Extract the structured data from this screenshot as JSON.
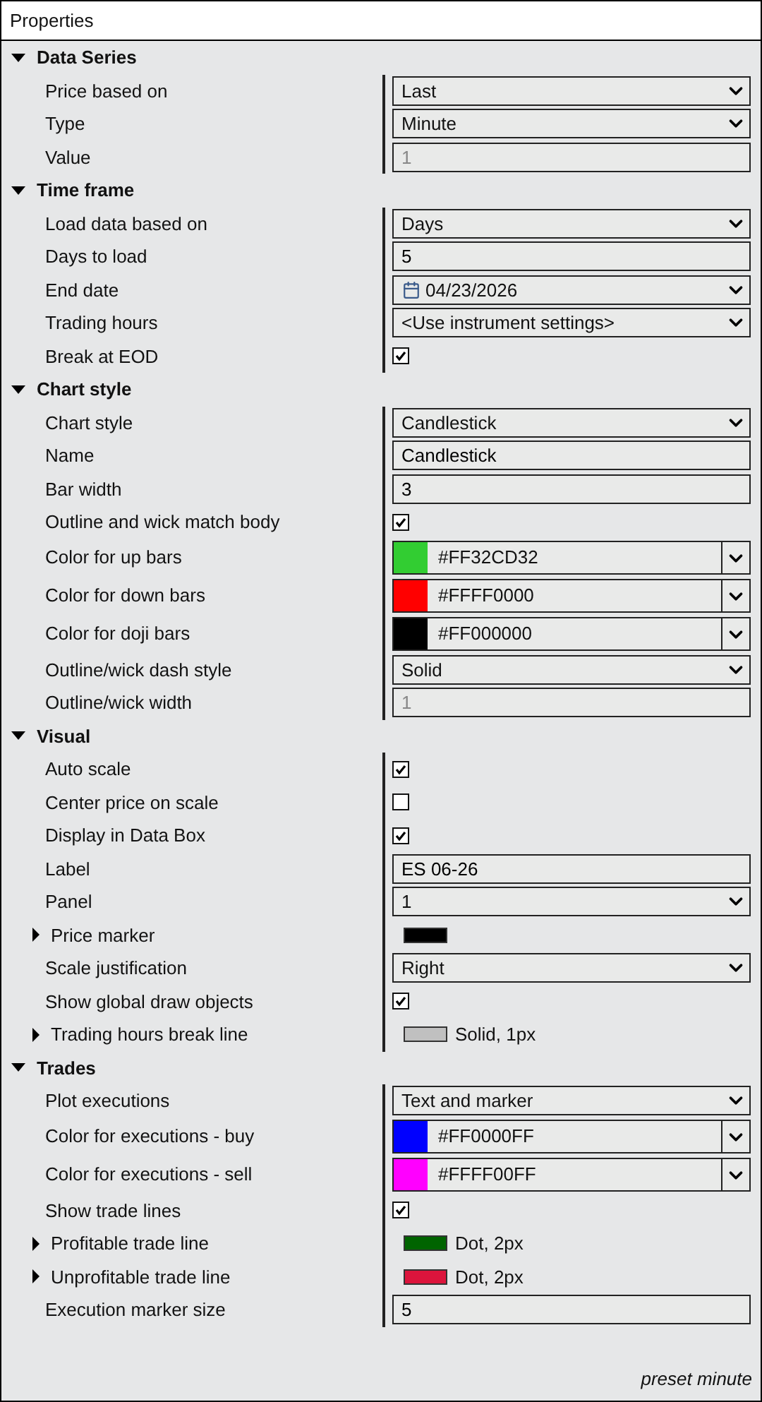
{
  "window": {
    "title": "Properties"
  },
  "sections": [
    {
      "title": "Data Series",
      "expanded": true,
      "rows": [
        {
          "label": "Price based on",
          "kind": "dropdown",
          "value": "Last"
        },
        {
          "label": "Type",
          "kind": "dropdown",
          "value": "Minute"
        },
        {
          "label": "Value",
          "kind": "text",
          "value": "1",
          "disabled": true
        }
      ]
    },
    {
      "title": "Time frame",
      "expanded": true,
      "rows": [
        {
          "label": "Load data based on",
          "kind": "dropdown",
          "value": "Days"
        },
        {
          "label": "Days to load",
          "kind": "text",
          "value": "5",
          "disabled": false
        },
        {
          "label": "End date",
          "kind": "date",
          "value": "04/23/2026"
        },
        {
          "label": "Trading hours",
          "kind": "dropdown",
          "value": "<Use instrument settings>"
        },
        {
          "label": "Break at EOD",
          "kind": "checkbox",
          "checked": true
        }
      ]
    },
    {
      "title": "Chart style",
      "expanded": true,
      "rows": [
        {
          "label": "Chart style",
          "kind": "dropdown",
          "value": "Candlestick"
        },
        {
          "label": "Name",
          "kind": "text",
          "value": "Candlestick",
          "disabled": false
        },
        {
          "label": "Bar width",
          "kind": "text",
          "value": "3",
          "disabled": false
        },
        {
          "label": "Outline and wick match body",
          "kind": "checkbox",
          "checked": true
        },
        {
          "label": "Color for up bars",
          "kind": "color",
          "color": "#32cd32",
          "value": "#FF32CD32"
        },
        {
          "label": "Color for down bars",
          "kind": "color",
          "color": "#ff0000",
          "value": "#FFFF0000"
        },
        {
          "label": "Color for doji bars",
          "kind": "color",
          "color": "#000000",
          "value": "#FF000000"
        },
        {
          "label": "Outline/wick dash style",
          "kind": "dropdown",
          "value": "Solid"
        },
        {
          "label": "Outline/wick width",
          "kind": "text",
          "value": "1",
          "disabled": true
        }
      ]
    },
    {
      "title": "Visual",
      "expanded": true,
      "rows": [
        {
          "label": "Auto scale",
          "kind": "checkbox",
          "checked": true
        },
        {
          "label": "Center price on scale",
          "kind": "checkbox",
          "checked": false
        },
        {
          "label": "Display in Data Box",
          "kind": "checkbox",
          "checked": true
        },
        {
          "label": "Label",
          "kind": "text",
          "value": "ES 06-26",
          "disabled": false
        },
        {
          "label": "Panel",
          "kind": "dropdown",
          "value": "1"
        },
        {
          "label": "Price marker",
          "kind": "stroke",
          "expanded": false,
          "color": "#000000"
        },
        {
          "label": "Scale justification",
          "kind": "dropdown",
          "value": "Right"
        },
        {
          "label": "Show global draw objects",
          "kind": "checkbox",
          "checked": true
        },
        {
          "label": "Trading hours break line",
          "kind": "stroke",
          "expanded": false,
          "color": "#c0c0c0",
          "value": "Solid, 1px"
        }
      ]
    },
    {
      "title": "Trades",
      "expanded": true,
      "rows": [
        {
          "label": "Plot executions",
          "kind": "dropdown",
          "value": "Text and marker"
        },
        {
          "label": "Color for executions - buy",
          "kind": "color",
          "color": "#0000ff",
          "value": "#FF0000FF"
        },
        {
          "label": "Color for executions - sell",
          "kind": "color",
          "color": "#ff00ff",
          "value": "#FFFF00FF"
        },
        {
          "label": "Show trade lines",
          "kind": "checkbox",
          "checked": true
        },
        {
          "label": "Profitable trade line",
          "kind": "stroke",
          "expanded": false,
          "color": "#006400",
          "value": "Dot, 2px"
        },
        {
          "label": "Unprofitable trade line",
          "kind": "stroke",
          "expanded": false,
          "color": "#dc143c",
          "value": "Dot, 2px"
        },
        {
          "label": "Execution marker size",
          "kind": "text",
          "value": "5",
          "disabled": false
        }
      ]
    }
  ],
  "footer": "preset minute"
}
